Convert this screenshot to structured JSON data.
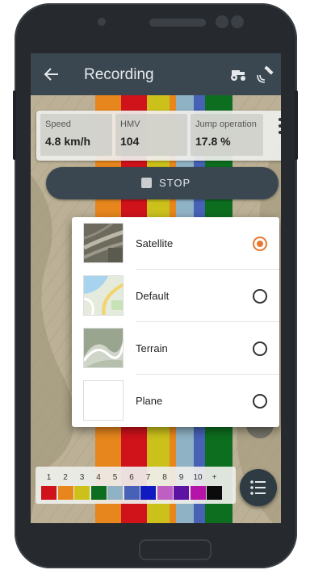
{
  "appbar": {
    "title": "Recording",
    "back_icon": "arrow-left-icon",
    "vehicle_icon": "tractor-icon",
    "gps_icon": "satellite-signal-icon"
  },
  "stats": [
    {
      "label": "Speed",
      "value": "4.8 km/h"
    },
    {
      "label": "HMV",
      "value": "104"
    },
    {
      "label": "Jump operation",
      "value": "17.8 %"
    }
  ],
  "stop_button": {
    "label": "STOP"
  },
  "map_types": {
    "options": [
      {
        "label": "Satellite",
        "selected": true
      },
      {
        "label": "Default",
        "selected": false
      },
      {
        "label": "Terrain",
        "selected": false
      },
      {
        "label": "Plane",
        "selected": false
      }
    ]
  },
  "legend": {
    "labels": [
      "1",
      "2",
      "3",
      "4",
      "5",
      "6",
      "7",
      "8",
      "9",
      "10",
      "+"
    ],
    "colors": [
      "#d0121b",
      "#e7861d",
      "#ccc11b",
      "#0d6e1f",
      "#8fb2c5",
      "#4661b6",
      "#0f1bc0",
      "#c05fc3",
      "#5d12a3",
      "#b614a8",
      "#0b0b0b"
    ]
  },
  "colors": {
    "accent": "#e8772e",
    "appbar": "#3a4750"
  }
}
